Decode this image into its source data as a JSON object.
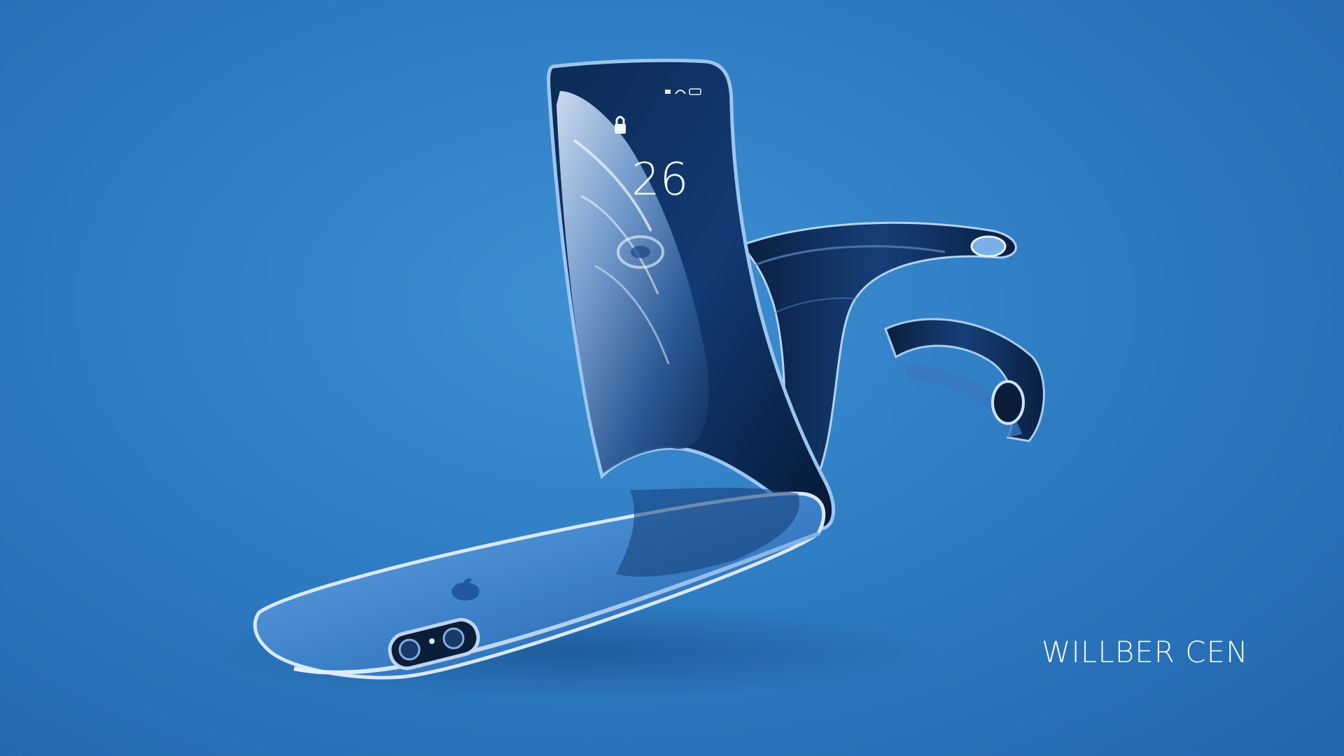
{
  "credit": {
    "text": "WILLBER CEN"
  },
  "phone": {
    "lock_screen_time": "26",
    "status_icons": [
      "signal-icon",
      "wifi-icon",
      "battery-icon"
    ],
    "lock_icon": "lock-icon",
    "back_logo": "apple-logo-icon"
  },
  "colors": {
    "background": "#2f7dc4",
    "phone_dark": "#0b2246",
    "phone_edge": "#bcd6f2",
    "credit_text": "#f4f8fc"
  }
}
